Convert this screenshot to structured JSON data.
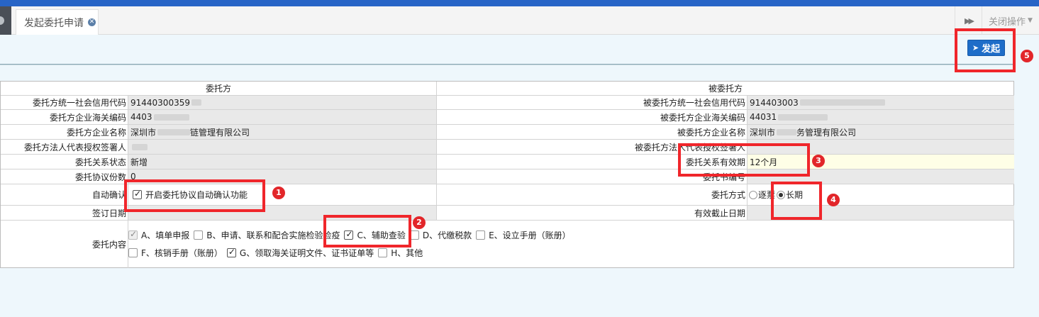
{
  "tabs": {
    "active_label": "发起委托申请",
    "close_ops_label": "关闭操作"
  },
  "toolbar": {
    "launch_label": "发起"
  },
  "form": {
    "principal_header": "委托方",
    "agent_header": "被委托方",
    "rows": {
      "credit_code": {
        "left_label": "委托方统一社会信用代码",
        "left_value": "91440300359",
        "right_label": "被委托方统一社会信用代码",
        "right_value": "914403003"
      },
      "customs_code": {
        "left_label": "委托方企业海关编码",
        "left_value": "4403",
        "right_label": "被委托方企业海关编码",
        "right_value": "44031"
      },
      "company_name": {
        "left_label": "委托方企业名称",
        "left_value_prefix": "深圳市",
        "left_value_suffix": "链管理有限公司",
        "right_label": "被委托方企业名称",
        "right_value_prefix": "深圳市",
        "right_value_suffix": "务管理有限公司"
      },
      "legal_rep": {
        "left_label": "委托方法人代表授权签署人",
        "right_label": "被委托方法人代表授权签署人"
      },
      "status": {
        "left_label": "委托关系状态",
        "left_value": "新增",
        "right_label": "委托关系有效期",
        "right_value": "12个月"
      },
      "copies": {
        "left_label": "委托协议份数",
        "left_value": "0",
        "right_label": "委托书编号"
      },
      "auto_confirm": {
        "left_label": "自动确认",
        "checkbox_label": "开启委托协议自动确认功能",
        "right_label": "委托方式",
        "radio_1_label": "逐票",
        "radio_2_label": "长期"
      },
      "dates": {
        "left_label": "签订日期",
        "right_label": "有效截止日期"
      },
      "content": {
        "label": "委托内容",
        "options": [
          {
            "label": "A、填单申报",
            "checked": true,
            "disabled": true
          },
          {
            "label": "B、申请、联系和配合实施检验检疫",
            "checked": false
          },
          {
            "label": "C、辅助查验",
            "checked": true
          },
          {
            "label": "D、代缴税款",
            "checked": false
          },
          {
            "label": "E、设立手册（账册）",
            "checked": false
          },
          {
            "label": "F、核销手册（账册）",
            "checked": false
          },
          {
            "label": "G、领取海关证明文件、证书证单等",
            "checked": true
          },
          {
            "label": "H、其他",
            "checked": false
          }
        ]
      }
    }
  },
  "annotations": {
    "badges": [
      "1",
      "2",
      "3",
      "4",
      "5"
    ]
  },
  "colors": {
    "accent": "#1e6dc8",
    "highlight": "#f0262b",
    "topbar": "#2764c6"
  },
  "icons": {
    "tab_close": "close-circle-icon",
    "scroll": "double-chevron-right-icon",
    "launch": "paper-plane-icon"
  }
}
